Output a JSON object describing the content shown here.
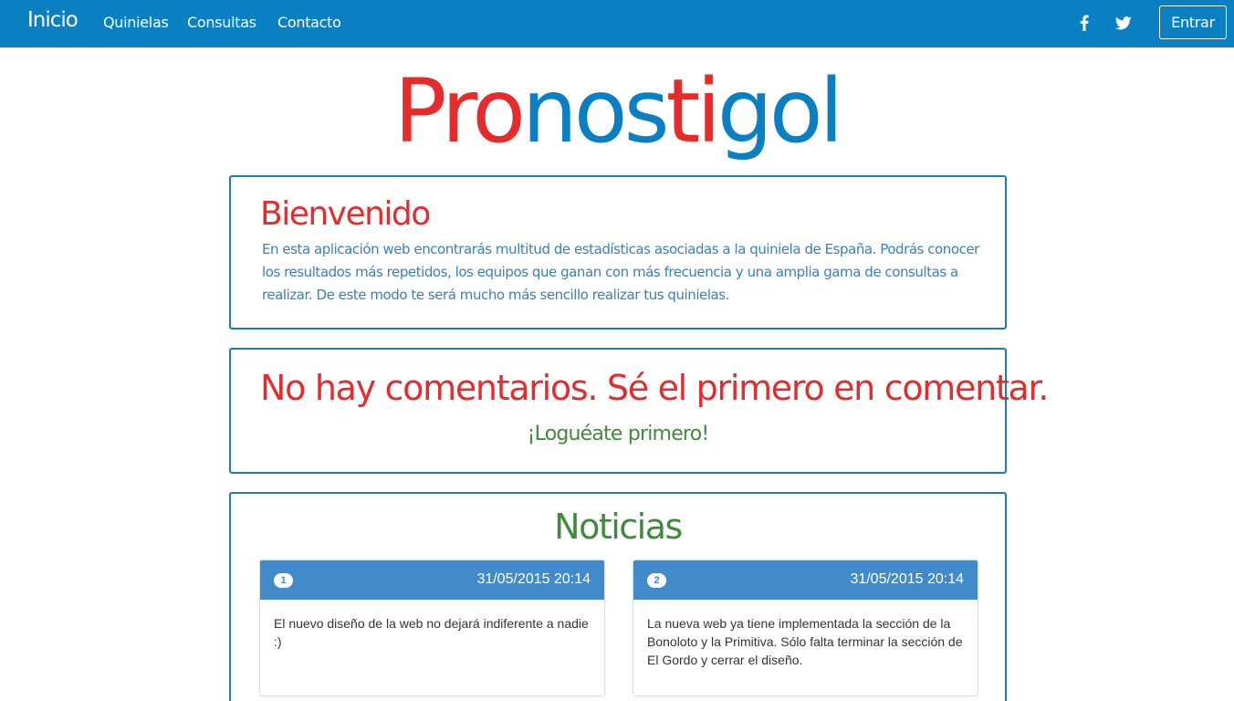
{
  "navbar": {
    "brand": "Inicio",
    "links": [
      "Quinielas",
      "Consultas",
      "Contacto"
    ],
    "social_icons": [
      "facebook-icon",
      "twitter-icon"
    ],
    "login_label": "Entrar"
  },
  "logo": {
    "segments": [
      {
        "text": "Pro",
        "color": "#e52b2b"
      },
      {
        "text": "nos",
        "color": "#0a7fc2"
      },
      {
        "text": "ti",
        "color": "#e52b2b"
      },
      {
        "text": "gol",
        "color": "#0a7fc2"
      }
    ]
  },
  "welcome": {
    "title": "Bienvenido",
    "text": "En esta aplicación web encontrarás multitud de estadísticas asociadas a la quiniela de España. Podrás conocer los resultados más repetidos, los equipos que ganan con más frecuencia y una amplia gama de consultas a realizar. De este modo te será mucho más sencillo realizar tus quinielas."
  },
  "comments": {
    "title": "No hay comentarios. Sé el primero en comentar.",
    "login_prompt": "¡Loguéate primero!"
  },
  "news": {
    "title": "Noticias",
    "items": [
      {
        "number": "1",
        "date": "31/05/2015 20:14",
        "text": "El nuevo diseño de la web no dejará indiferente a nadie :)"
      },
      {
        "number": "2",
        "date": "31/05/2015 20:14",
        "text": "La nueva web ya tiene implementada la sección de la Bonoloto y la Primitiva. Sólo falta terminar la sección de El Gordo y cerrar el diseño."
      }
    ]
  },
  "colors": {
    "navbar": "#0a80c2",
    "red_accent": "#e52b2b",
    "blue_accent": "#0a7fc2",
    "green_accent": "#3f8a3b",
    "card_header": "#428bca"
  }
}
